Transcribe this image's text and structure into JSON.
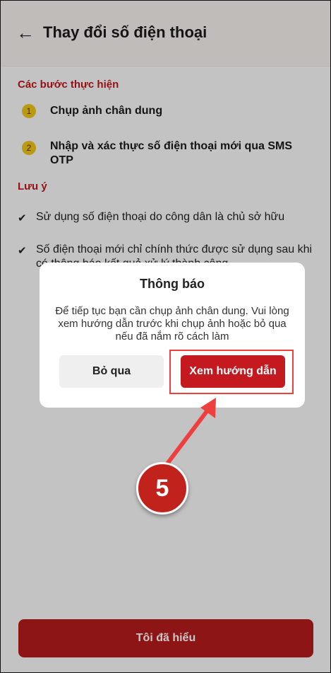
{
  "header": {
    "back_icon": "arrow-left-icon",
    "title": "Thay đổi số điện thoại"
  },
  "steps": {
    "heading": "Các bước thực hiện",
    "items": [
      {
        "number": "1",
        "label": "Chụp ảnh chân dung"
      },
      {
        "number": "2",
        "label": "Nhập và xác thực số điện thoại mới qua SMS OTP"
      }
    ]
  },
  "notes": {
    "heading": "Lưu ý",
    "items": [
      "Sử dụng số điện thoại do công dân là chủ sở hữu",
      "Số điện thoại mới chỉ chính thức được sử dụng sau khi có thông báo kết quả xử lý thành công"
    ]
  },
  "primary_button": {
    "label": "Tôi đã hiểu"
  },
  "dialog": {
    "title": "Thông báo",
    "message": "Để tiếp tục bạn cần chụp ảnh chân dung. Vui lòng xem hướng dẫn trước khi chụp ảnh hoặc bỏ qua nếu đã nắm rõ cách làm",
    "skip_label": "Bỏ qua",
    "guide_label": "Xem hướng dẫn"
  },
  "annotation": {
    "step_number": "5"
  },
  "colors": {
    "accent": "#c41a1f",
    "step_badge": "#f0c419",
    "annotation": "#ee3f3f"
  }
}
